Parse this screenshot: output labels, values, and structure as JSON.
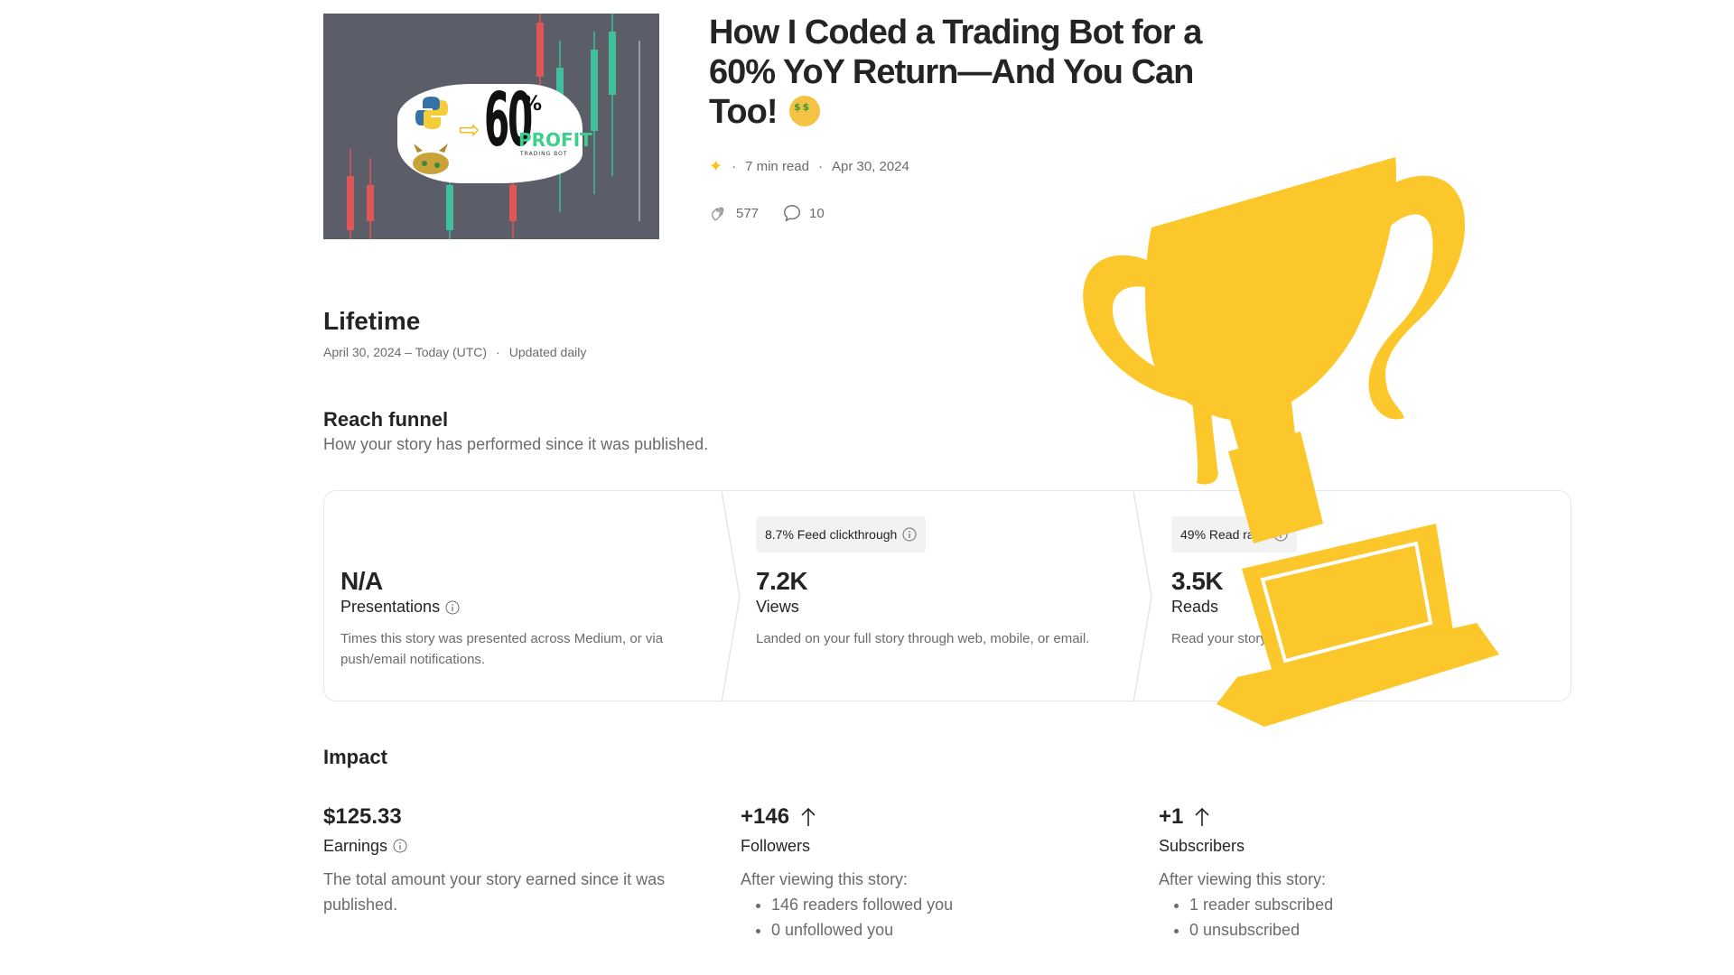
{
  "article": {
    "title": "How I Coded a Trading Bot for a 60% YoY Return—And You Can Too!",
    "read_time": "7 min read",
    "date": "Apr 30, 2024",
    "claps": "577",
    "responses": "10",
    "thumbnail": {
      "big_text": "60",
      "percent_sign": "%",
      "profit_text": "PROFIT",
      "subtitle": "TRADING BOT"
    }
  },
  "lifetime": {
    "title": "Lifetime",
    "range": "April 30, 2024 – Today (UTC)",
    "update": "Updated daily"
  },
  "funnel": {
    "title": "Reach funnel",
    "subtitle": "How your story has performed since it was published.",
    "columns": [
      {
        "value": "N/A",
        "label": "Presentations",
        "description": "Times this story was presented across Medium, or via push/email notifications."
      },
      {
        "pill": "8.7% Feed clickthrough",
        "value": "7.2K",
        "label": "Views",
        "description": "Landed on your full story through web, mobile, or email."
      },
      {
        "pill": "49% Read ratio",
        "value": "3.5K",
        "label": "Reads",
        "description": "Read your story for a"
      }
    ]
  },
  "impact": {
    "title": "Impact",
    "earnings": {
      "value": "$125.33",
      "label": "Earnings",
      "description": "The total amount your story earned since it was published."
    },
    "followers": {
      "value": "+146",
      "label": "Followers",
      "intro": "After viewing this story:",
      "items": [
        "146 readers followed you",
        "0 unfollowed you"
      ]
    },
    "subscribers": {
      "value": "+1",
      "label": "Subscribers",
      "intro": "After viewing this story:",
      "items": [
        "1 reader subscribed",
        "0 unsubscribed"
      ]
    }
  },
  "colors": {
    "trophy": "#fcc72a",
    "text_primary": "#242424",
    "text_secondary": "#6b6b6b",
    "member_star": "#ffc017"
  }
}
